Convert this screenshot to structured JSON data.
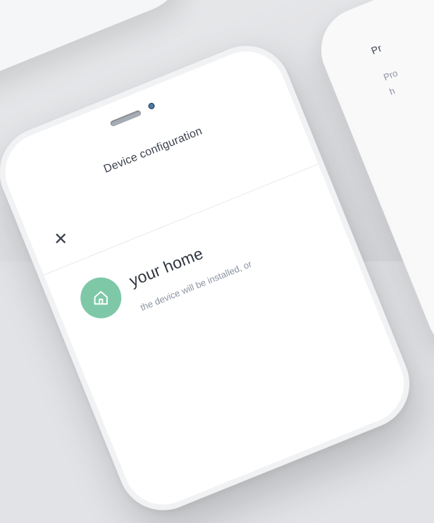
{
  "header": {
    "title": "Device configuration"
  },
  "main": {
    "heading": "your home",
    "description": "the device will be installed, or"
  },
  "peek_card": {
    "title": "Pr",
    "line1": "Pro",
    "line2": "h"
  },
  "colors": {
    "accent": "#7ec8a8",
    "text_primary": "#2f3640",
    "text_secondary": "#8a93a0"
  },
  "icons": {
    "close": "close-icon",
    "home": "home-icon"
  }
}
